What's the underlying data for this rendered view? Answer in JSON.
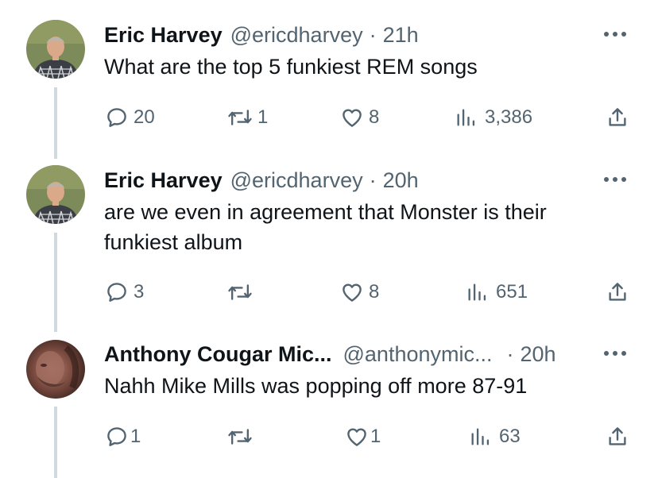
{
  "tweets": [
    {
      "name": "Eric Harvey",
      "handle": "@ericdharvey",
      "dot": "·",
      "time": "21h",
      "text": "What are the top 5 funkiest REM songs",
      "replies": "20",
      "retweets": "1",
      "likes": "8",
      "views": "3,386"
    },
    {
      "name": "Eric Harvey",
      "handle": "@ericdharvey",
      "dot": "·",
      "time": "20h",
      "text": "are we even in agreement that Monster is their funkiest album",
      "replies": "3",
      "retweets": "",
      "likes": "8",
      "views": "651"
    },
    {
      "name": "Anthony Cougar Mic...",
      "handle": "@anthonymic...",
      "dot": "·",
      "time": "20h",
      "text": "Nahh Mike Mills was popping off more 87-91",
      "replies": "1",
      "retweets": "",
      "likes": "1",
      "views": "63"
    }
  ],
  "icons": {
    "avatar_1": "avatar-man-plaid-shirt",
    "avatar_3": "avatar-bearded-face",
    "reply": "reply-icon",
    "retweet": "retweet-icon",
    "like": "heart-icon",
    "views": "views-chart-icon",
    "share": "share-icon",
    "more": "more-icon"
  },
  "colors": {
    "text": "#0f1419",
    "secondary": "#536471",
    "thread_line": "#cfd9de"
  }
}
